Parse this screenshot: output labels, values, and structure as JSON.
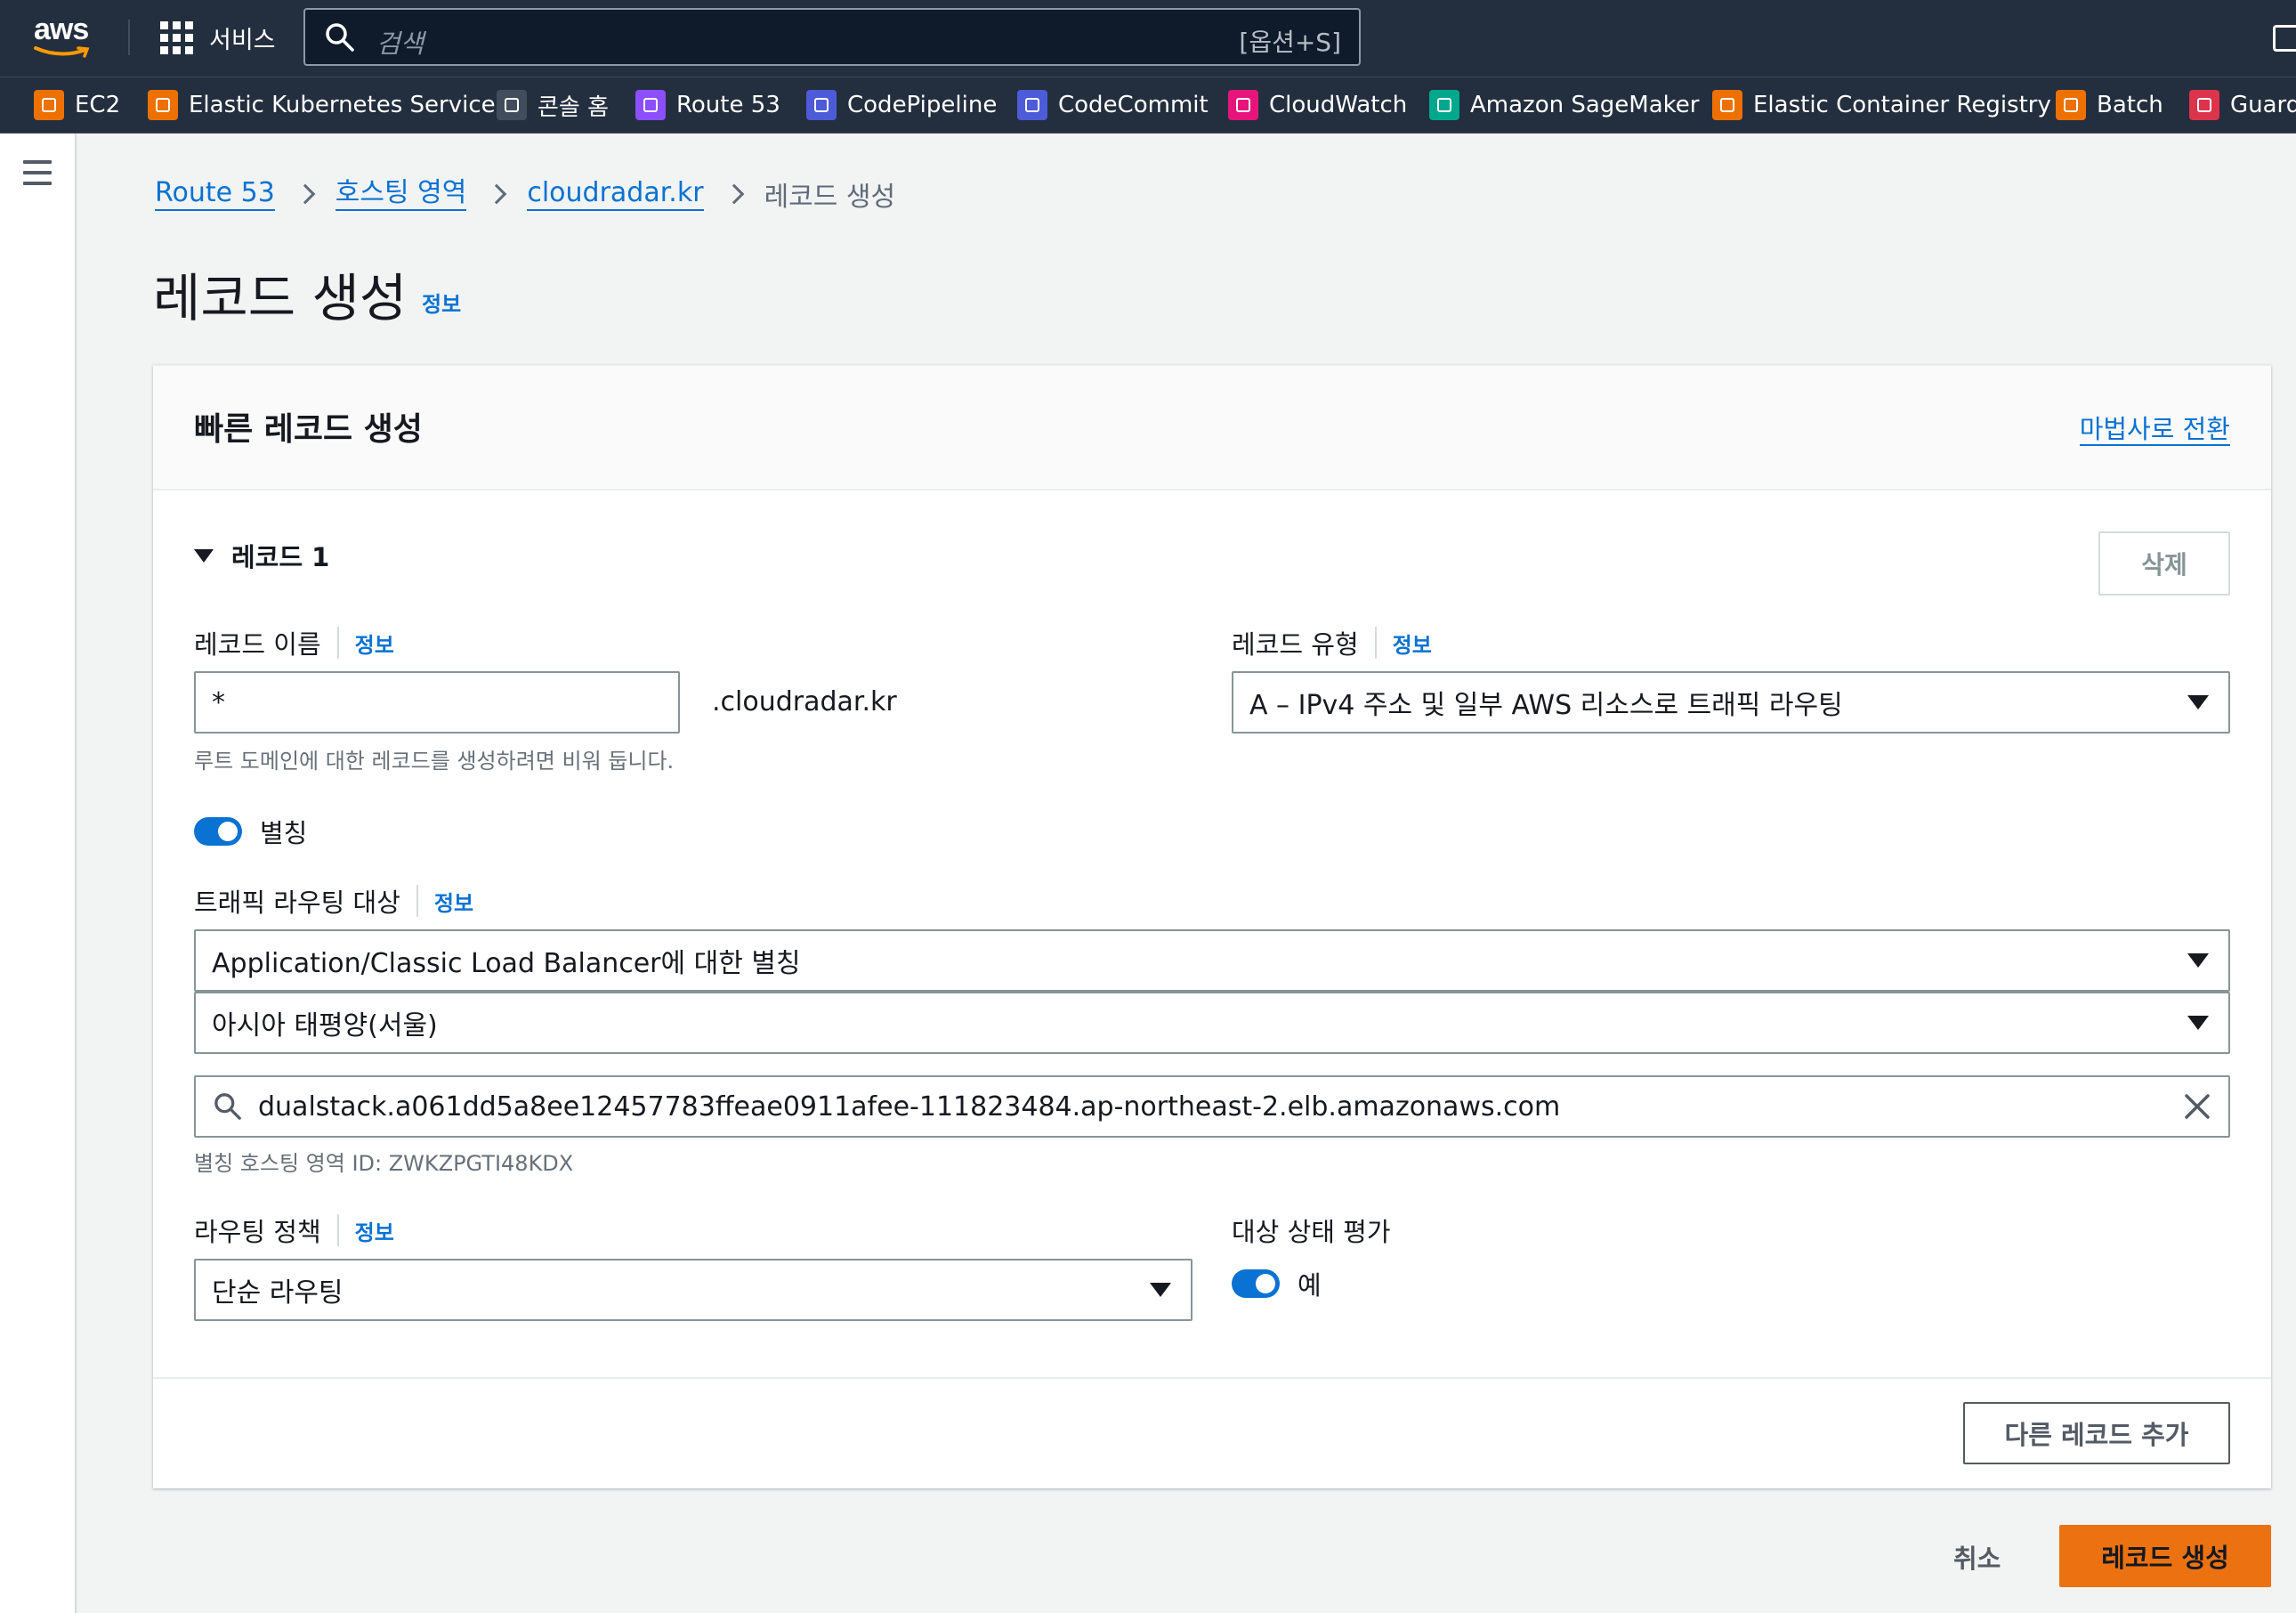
{
  "nav": {
    "logo": "aws",
    "services": "서비스",
    "search_placeholder": "검색",
    "search_shortcut": "[옵션+S]"
  },
  "favorites": [
    {
      "label": "EC2",
      "icon": "ec2-icon",
      "color": "#ed7100"
    },
    {
      "label": "Elastic Kubernetes Service",
      "icon": "eks-icon",
      "color": "#ed7100"
    },
    {
      "label": "콘솔 홈",
      "icon": "console-home-icon",
      "color": "#414d5c"
    },
    {
      "label": "Route 53",
      "icon": "route53-icon",
      "color": "#8c4fff"
    },
    {
      "label": "CodePipeline",
      "icon": "codepipeline-icon",
      "color": "#4d5bd8"
    },
    {
      "label": "CodeCommit",
      "icon": "codecommit-icon",
      "color": "#4d5bd8"
    },
    {
      "label": "CloudWatch",
      "icon": "cloudwatch-icon",
      "color": "#e7157b"
    },
    {
      "label": "Amazon SageMaker",
      "icon": "sagemaker-icon",
      "color": "#01a88d"
    },
    {
      "label": "Elastic Container Registry",
      "icon": "ecr-icon",
      "color": "#ed7100"
    },
    {
      "label": "Batch",
      "icon": "batch-icon",
      "color": "#ed7100"
    },
    {
      "label": "Guard",
      "icon": "guardduty-icon",
      "color": "#dd344c"
    }
  ],
  "breadcrumb": {
    "items": [
      "Route 53",
      "호스팅 영역",
      "cloudradar.kr"
    ],
    "current": "레코드 생성"
  },
  "page": {
    "title": "레코드 생성",
    "info": "정보"
  },
  "panel": {
    "header": "빠른 레코드 생성",
    "wizard_link": "마법사로 전환",
    "record_title": "레코드 1",
    "delete_button": "삭제",
    "record_name_label": "레코드 이름",
    "record_name_info": "정보",
    "record_name_value": "*",
    "domain_suffix": ".cloudradar.kr",
    "record_name_hint": "루트 도메인에 대한 레코드를 생성하려면 비워 둡니다.",
    "record_type_label": "레코드 유형",
    "record_type_info": "정보",
    "record_type_value": "A – IPv4 주소 및 일부 AWS 리소스로 트래픽 라우팅",
    "alias_label": "별칭",
    "route_target_label": "트래픽 라우팅 대상",
    "route_target_info": "정보",
    "endpoint_type": "Application/Classic Load Balancer에 대한 별칭",
    "region": "아시아 태평양(서울)",
    "endpoint_value": "dualstack.a061dd5a8ee12457783ffeae0911afee-111823484.ap-northeast-2.elb.amazonaws.com",
    "alias_zone_hint": "별칭 호스팅 영역 ID: ZWKZPGTI48KDX",
    "routing_policy_label": "라우팅 정책",
    "routing_policy_info": "정보",
    "routing_policy_value": "단순 라우팅",
    "health_label": "대상 상태 평가",
    "health_value": "예",
    "add_record_button": "다른 레코드 추가"
  },
  "footer": {
    "cancel": "취소",
    "create": "레코드 생성"
  }
}
